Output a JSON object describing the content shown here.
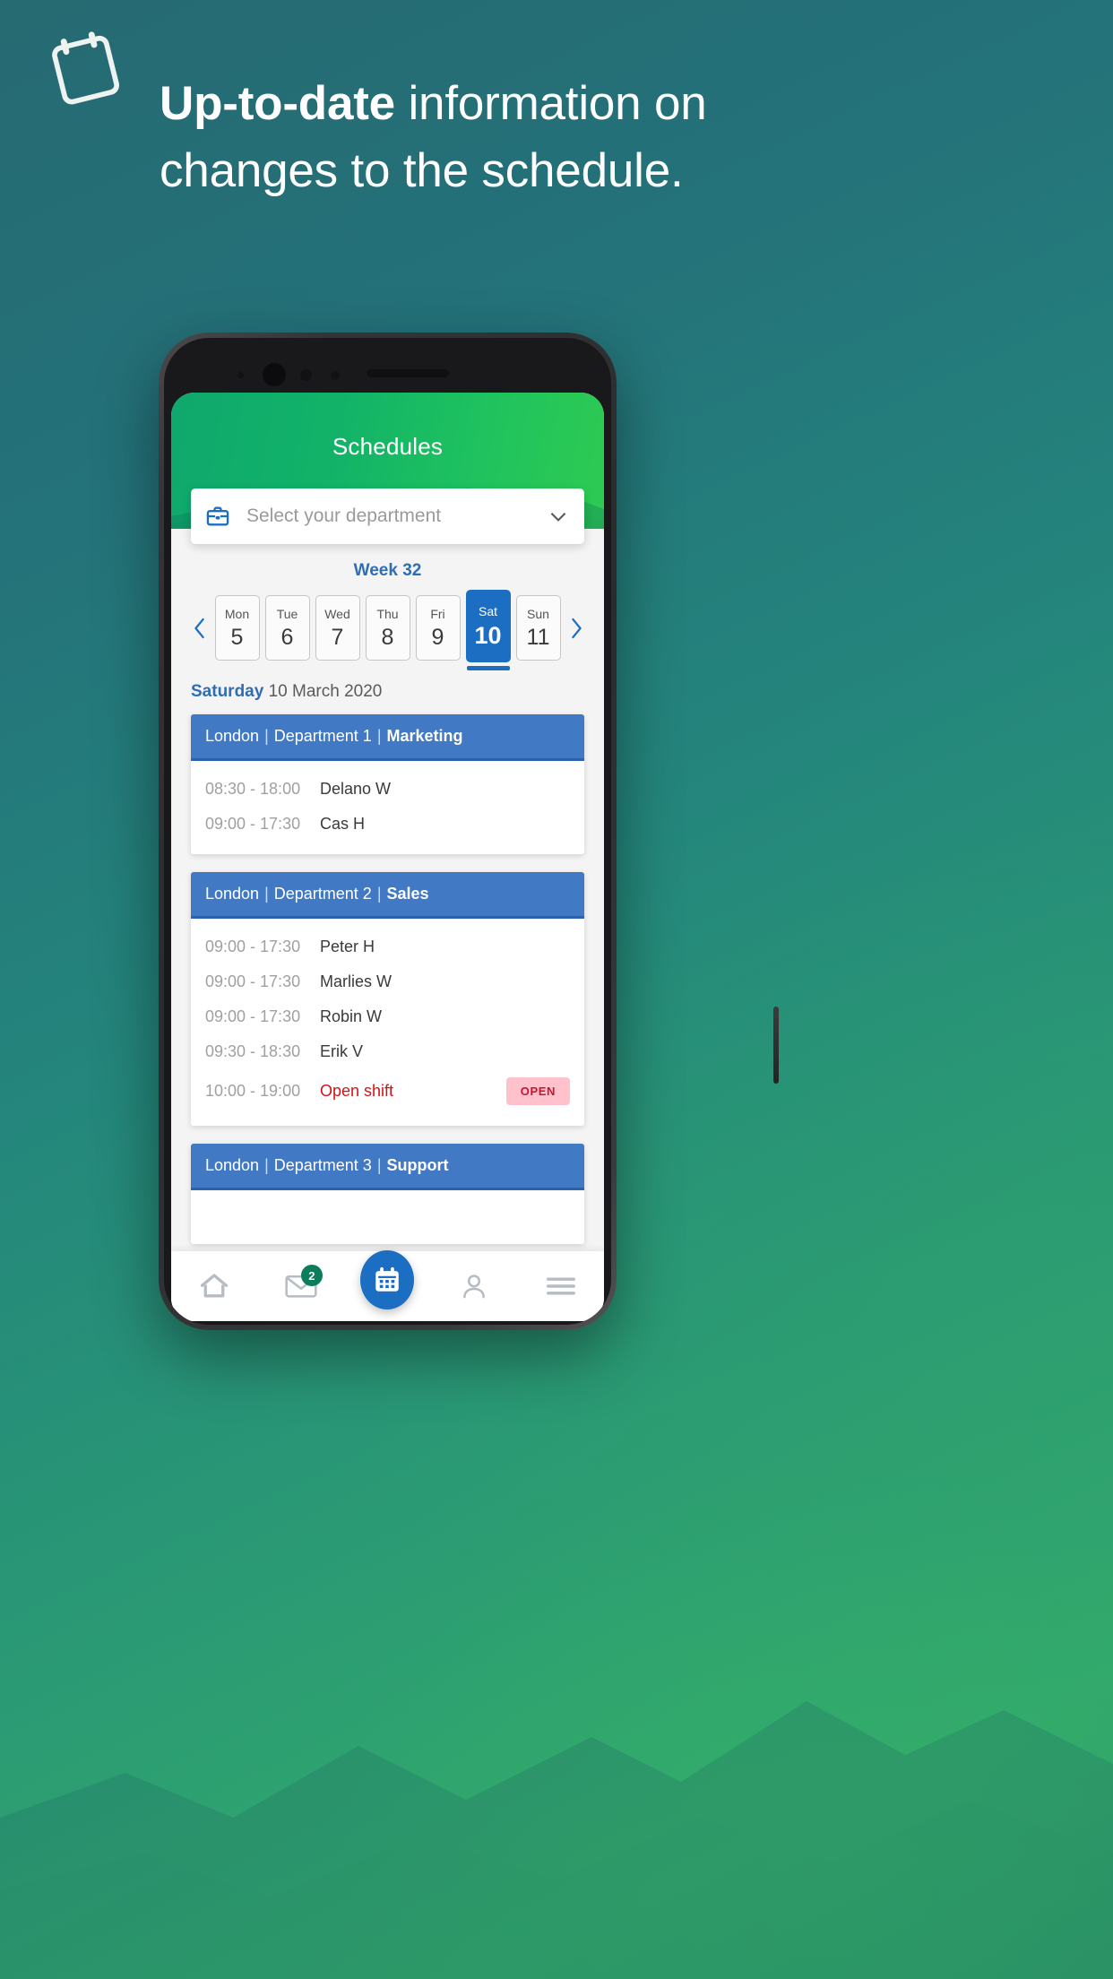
{
  "promo": {
    "headline_bold": "Up-to-date",
    "headline_rest": " information on changes to the schedule.",
    "logo_icon": "calendar-icon"
  },
  "app": {
    "title": "Schedules",
    "department_select": {
      "icon": "briefcase-icon",
      "placeholder": "Select your department",
      "value": "",
      "chevron_icon": "chevron-down-icon"
    },
    "week_label": "Week 32",
    "prev_icon": "chevron-left-icon",
    "next_icon": "chevron-right-icon",
    "days": [
      {
        "dow": "Mon",
        "num": "5",
        "active": false
      },
      {
        "dow": "Tue",
        "num": "6",
        "active": false
      },
      {
        "dow": "Wed",
        "num": "7",
        "active": false
      },
      {
        "dow": "Thu",
        "num": "8",
        "active": false
      },
      {
        "dow": "Fri",
        "num": "9",
        "active": false
      },
      {
        "dow": "Sat",
        "num": "10",
        "active": true
      },
      {
        "dow": "Sun",
        "num": "11",
        "active": false
      }
    ],
    "selected_date": {
      "day_name": "Saturday",
      "rest": " 10 March 2020"
    },
    "cards": [
      {
        "location": "London",
        "department": "Department 1",
        "team": "Marketing",
        "shifts": [
          {
            "time": "08:30 - 18:00",
            "name": "Delano W",
            "open": false,
            "badge": ""
          },
          {
            "time": "09:00 - 17:30",
            "name": "Cas H",
            "open": false,
            "badge": ""
          }
        ]
      },
      {
        "location": "London",
        "department": "Department 2",
        "team": "Sales",
        "shifts": [
          {
            "time": "09:00 - 17:30",
            "name": "Peter H",
            "open": false,
            "badge": ""
          },
          {
            "time": "09:00 - 17:30",
            "name": "Marlies W",
            "open": false,
            "badge": ""
          },
          {
            "time": "09:00 - 17:30",
            "name": "Robin W",
            "open": false,
            "badge": ""
          },
          {
            "time": "09:30 - 18:30",
            "name": "Erik V",
            "open": false,
            "badge": ""
          },
          {
            "time": "10:00 - 19:00",
            "name": "Open shift",
            "open": true,
            "badge": "OPEN"
          }
        ]
      },
      {
        "location": "London",
        "department": "Department 3",
        "team": "Support",
        "shifts": []
      }
    ],
    "separator": "|",
    "bottom_nav": [
      {
        "icon": "home-icon",
        "badge": "",
        "active": false
      },
      {
        "icon": "mail-icon",
        "badge": "2",
        "active": false
      },
      {
        "icon": "calendar-icon",
        "badge": "",
        "active": true
      },
      {
        "icon": "person-icon",
        "badge": "",
        "active": false
      },
      {
        "icon": "menu-icon",
        "badge": "",
        "active": false
      }
    ]
  },
  "colors": {
    "brand_blue": "#1b6ec2",
    "card_header_blue": "#4279c4",
    "open_red": "#d31217",
    "badge_bg": "#ffc2cd",
    "badge_text": "#c21733",
    "header_green": "#12b368",
    "background_teal": "#24727a"
  }
}
